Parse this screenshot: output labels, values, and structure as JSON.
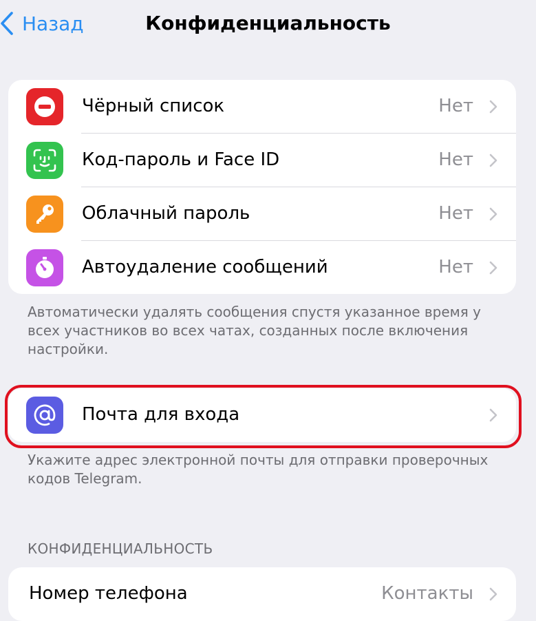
{
  "nav": {
    "back_label": "Назад",
    "title": "Конфиденциальность"
  },
  "main_group": {
    "items": [
      {
        "label": "Чёрный список",
        "value": "Нет",
        "icon": "blocked-icon",
        "color": "#e5252a"
      },
      {
        "label": "Код-пароль и Face ID",
        "value": "Нет",
        "icon": "face-id-icon",
        "color": "#33c34f"
      },
      {
        "label": "Облачный пароль",
        "value": "Нет",
        "icon": "key-icon",
        "color": "#f7921e"
      },
      {
        "label": "Автоудаление сообщений",
        "value": "Нет",
        "icon": "timer-icon",
        "color": "#c552e6"
      }
    ],
    "footer": "Автоматически удалять сообщения спустя указанное время у всех участников во всех чатах, созданных после включения настройки."
  },
  "email_group": {
    "label": "Почта для входа",
    "icon": "at-sign-icon",
    "color": "#5b5ce2",
    "footer": "Укажите адрес электронной почты для отправки проверочных кодов Telegram."
  },
  "privacy_section": {
    "header": "КОНФИДЕНЦИАЛЬНОСТЬ",
    "items": [
      {
        "label": "Номер телефона",
        "value": "Контакты"
      }
    ]
  },
  "colors": {
    "accent": "#2a8ef2",
    "highlight": "#e0101f",
    "background": "#efeff4"
  }
}
